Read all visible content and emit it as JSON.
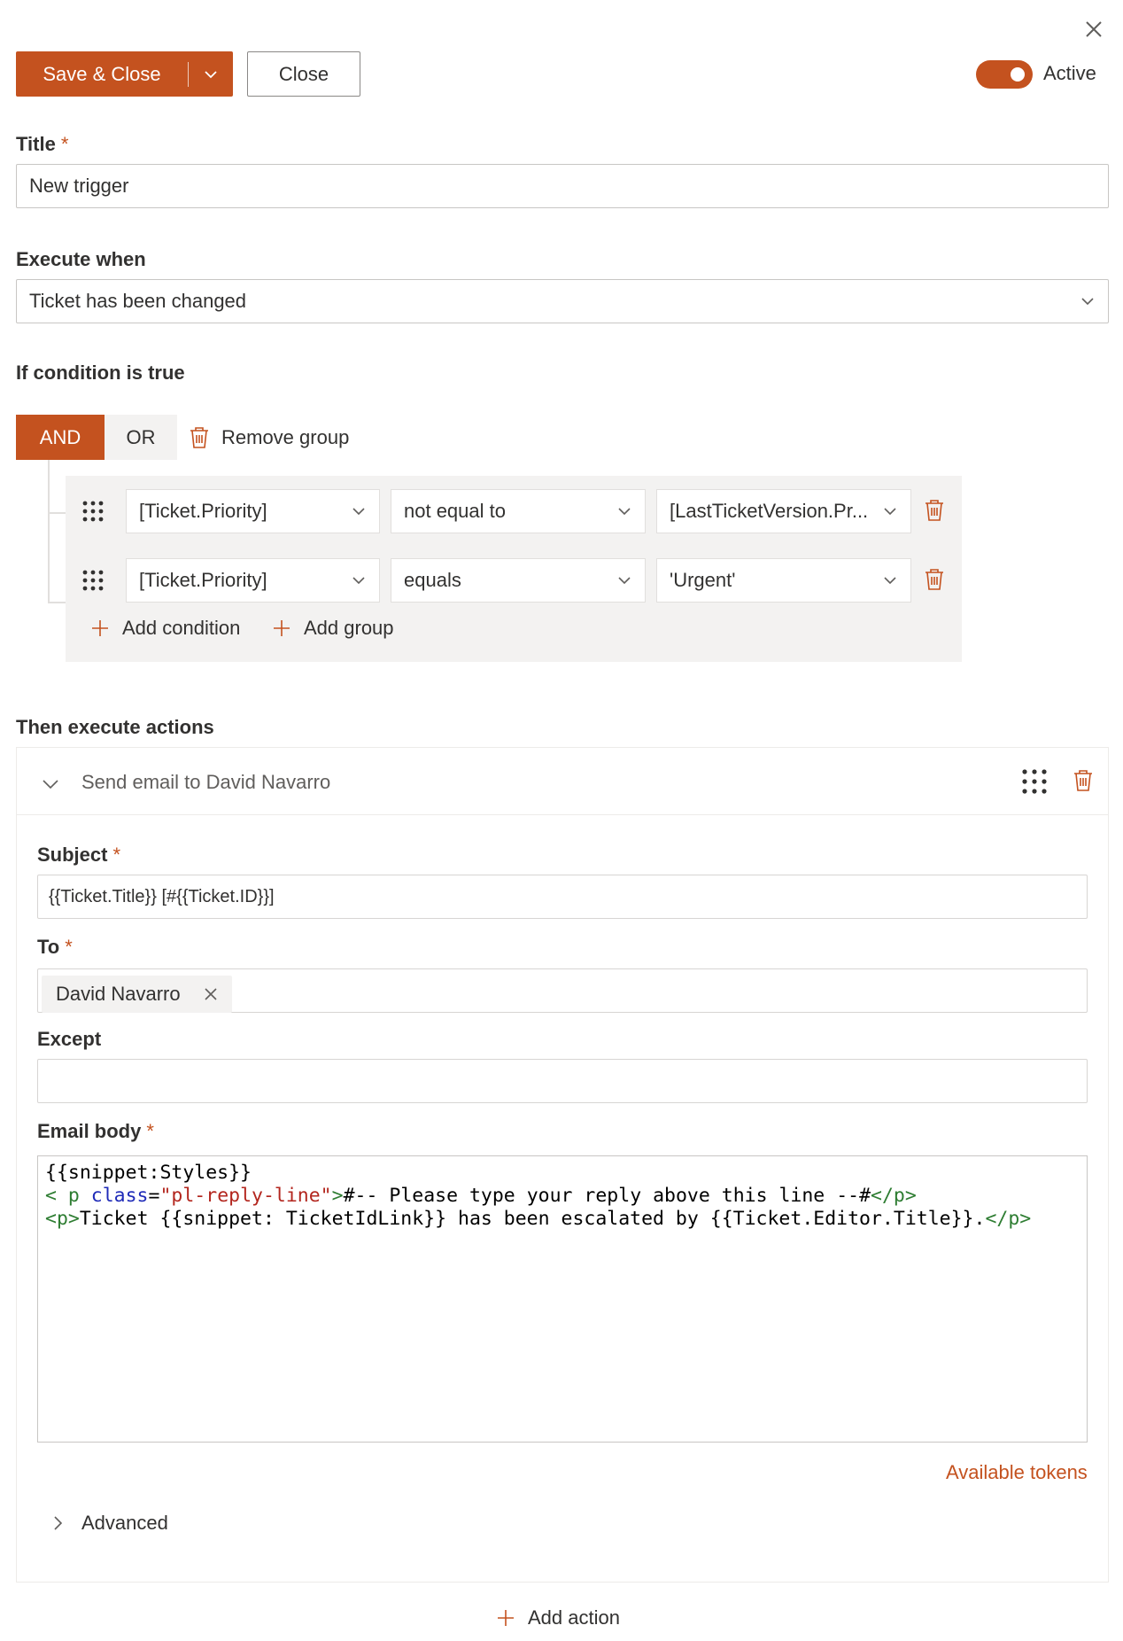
{
  "toolbar": {
    "save_close_label": "Save & Close",
    "close_label": "Close",
    "active_label": "Active",
    "active": true
  },
  "form": {
    "title_label": "Title",
    "title_value": "New trigger",
    "execute_label": "Execute when",
    "execute_value": "Ticket has been changed",
    "condition_label": "If condition is true"
  },
  "group": {
    "and_label": "AND",
    "or_label": "OR",
    "remove_label": "Remove group",
    "conditions": [
      {
        "field": "[Ticket.Priority]",
        "operator": "not equal to",
        "value": "[LastTicketVersion.Pr..."
      },
      {
        "field": "[Ticket.Priority]",
        "operator": "equals",
        "value": "'Urgent'"
      }
    ],
    "add_condition_label": "Add condition",
    "add_group_label": "Add group"
  },
  "actions": {
    "section_label": "Then execute actions",
    "items": [
      {
        "title": "Send email to David Navarro",
        "subject_label": "Subject",
        "subject_value": "{{Ticket.Title}} [#{{Ticket.ID}}]",
        "to_label": "To",
        "to_person": "David Navarro",
        "except_label": "Except",
        "except_value": "",
        "body_label": "Email body",
        "body": {
          "line1": "{{snippet:Styles}}",
          "line2_tag_open": "< p ",
          "line2_attr": "class",
          "line2_eq": "=",
          "line2_str": "\"pl-reply-line\"",
          "line2_gt": ">",
          "line2_text": "#-- Please type your reply above this line --#",
          "line2_tag_close": "</p>",
          "line3_tag_open": "<p>",
          "line3_text": "Ticket {{snippet: TicketIdLink}} has been escalated by {{Ticket.Editor.Title}}.",
          "line3_tag_close": "</p>"
        },
        "tokens_label": "Available tokens",
        "advanced_label": "Advanced"
      }
    ],
    "add_action_label": "Add action"
  },
  "colors": {
    "accent": "#c4521f",
    "panel_grey": "#f3f2f1",
    "border": "#c8c6c4"
  }
}
